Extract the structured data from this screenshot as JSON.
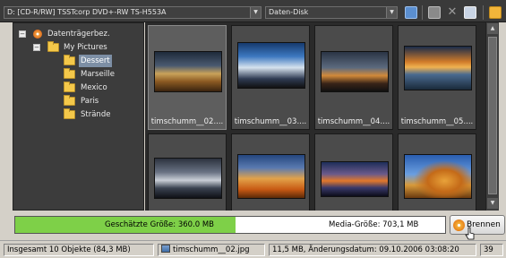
{
  "toolbar": {
    "drive_select": "D: [CD-R/RW] TSSTcorp DVD+-RW TS-H553A",
    "disc_type_select": "Daten-Disk",
    "icons": [
      "view-icon",
      "copy-icon",
      "delete-icon",
      "properties-icon",
      "folder-icon"
    ]
  },
  "tree": {
    "root_label": "Datenträgerbez.",
    "pictures_label": "My Pictures",
    "folders": [
      "Dessert",
      "Marseille",
      "Mexico",
      "Paris",
      "Strände"
    ],
    "selected_folder": "Dessert"
  },
  "thumbnails": [
    {
      "caption": "timschumm__02....",
      "scene": "desert-dusk"
    },
    {
      "caption": "timschumm__03....",
      "scene": "blue-sky-clouds"
    },
    {
      "caption": "timschumm__04....",
      "scene": "sunset-horizon"
    },
    {
      "caption": "timschumm__05....",
      "scene": "lake-sunset"
    },
    {
      "caption": "",
      "scene": "stormy-lake"
    },
    {
      "caption": "",
      "scene": "orange-fields"
    },
    {
      "caption": "",
      "scene": "bridge-sunset"
    },
    {
      "caption": "",
      "scene": "autumn-tree"
    }
  ],
  "capacity": {
    "estimated_label": "Geschätzte Größe: 360.0 MB",
    "media_label": "Media-Größe: 703,1 MB",
    "used_fraction": 0.512,
    "fill_color": "#7ed048"
  },
  "burn_button": {
    "label": "Brennen"
  },
  "status": {
    "total": "Insgesamt 10 Objekte (84,3 MB)",
    "file_name": "timschumm__02.jpg",
    "file_info": "11,5 MB, Änderungsdatum: 09.10.2006 03:08:20",
    "extra": "39"
  }
}
